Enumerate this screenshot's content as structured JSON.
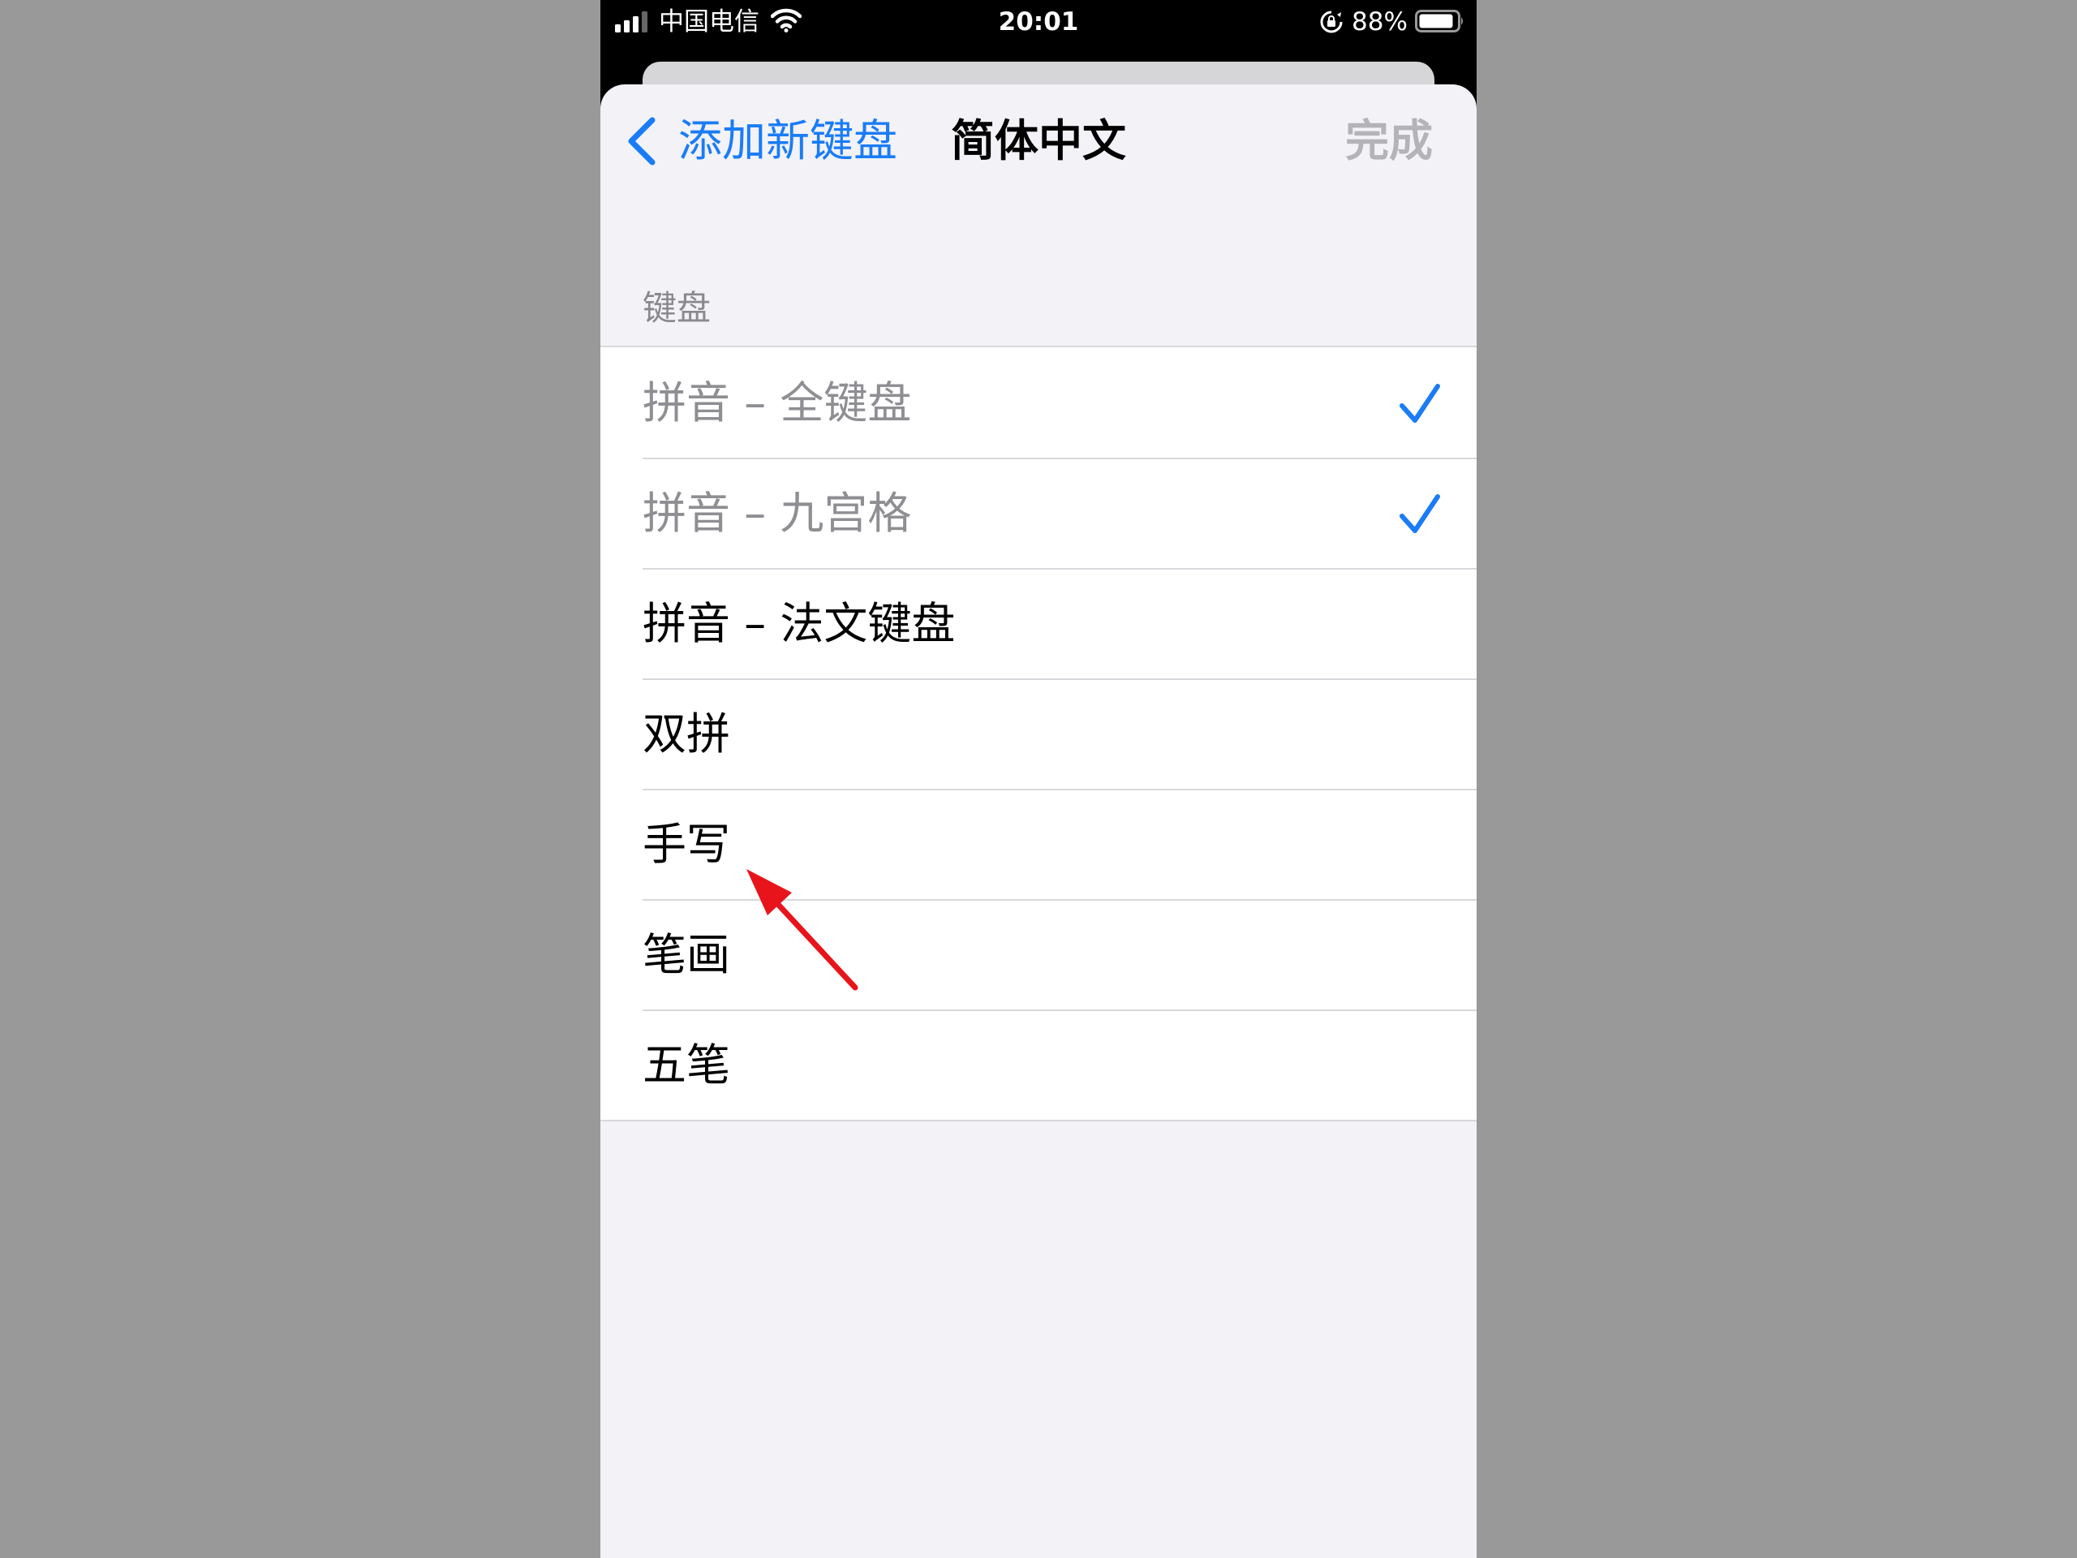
{
  "status_bar": {
    "carrier": "中国电信",
    "time": "20:01",
    "battery_percent": "88%"
  },
  "nav": {
    "back_label": "添加新键盘",
    "title": "简体中文",
    "done_label": "完成"
  },
  "section_header": "键盘",
  "keyboards": [
    {
      "label": "拼音 – 全键盘",
      "checked": true,
      "disabled": true
    },
    {
      "label": "拼音 – 九宫格",
      "checked": true,
      "disabled": true
    },
    {
      "label": "拼音 – 法文键盘",
      "checked": false,
      "disabled": false
    },
    {
      "label": "双拼",
      "checked": false,
      "disabled": false
    },
    {
      "label": "手写",
      "checked": false,
      "disabled": false
    },
    {
      "label": "笔画",
      "checked": false,
      "disabled": false
    },
    {
      "label": "五笔",
      "checked": false,
      "disabled": false
    }
  ],
  "colors": {
    "accent": "#1a7cf6",
    "annotation": "#e8141b",
    "page_background": "#999999"
  },
  "icons": [
    "signal-icon",
    "wifi-icon",
    "rotation-lock-icon",
    "battery-icon",
    "chevron-left-icon",
    "checkmark-icon",
    "annotation-arrow"
  ]
}
